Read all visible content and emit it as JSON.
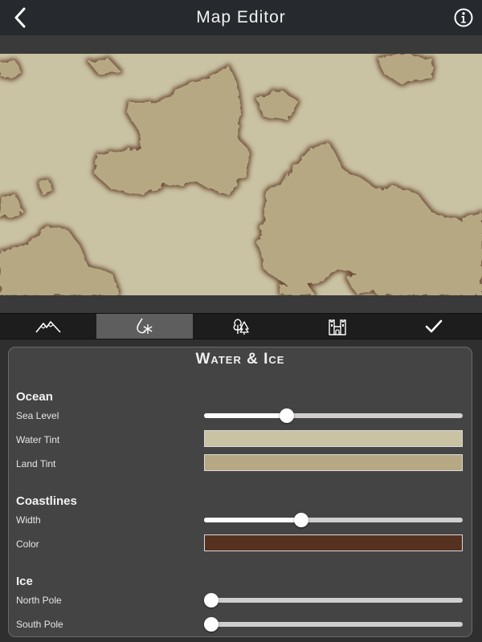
{
  "header": {
    "title": "Map Editor",
    "back_icon": "chevron-left-icon",
    "info_icon": "info-circle-icon"
  },
  "toolbar": {
    "tools": [
      {
        "name": "terrain",
        "icon": "mountains-icon",
        "active": false
      },
      {
        "name": "water-ice",
        "icon": "water-ice-icon",
        "active": true
      },
      {
        "name": "vegetation",
        "icon": "trees-icon",
        "active": false
      },
      {
        "name": "settlements",
        "icon": "castle-icon",
        "active": false
      },
      {
        "name": "done",
        "icon": "checkmark-icon",
        "active": false
      }
    ]
  },
  "panel": {
    "title": "Water & Ice",
    "ocean": {
      "heading": "Ocean",
      "sea_level_label": "Sea Level",
      "sea_level_value": 0.31,
      "water_tint_label": "Water Tint",
      "water_tint_color": "#c9c2a3",
      "land_tint_label": "Land Tint",
      "land_tint_color": "#b7a884"
    },
    "coastlines": {
      "heading": "Coastlines",
      "width_label": "Width",
      "width_value": 0.37,
      "color_label": "Color",
      "color_value": "#56311f"
    },
    "ice": {
      "heading": "Ice",
      "north_pole_label": "North Pole",
      "north_pole_value": 0.0,
      "south_pole_label": "South Pole",
      "south_pole_value": 0.0
    }
  },
  "colors": {
    "ocean": "#c9c2a3",
    "land": "#b7a884",
    "coast": "#6b4a33",
    "toolbar_active": "#5e5e5e"
  }
}
